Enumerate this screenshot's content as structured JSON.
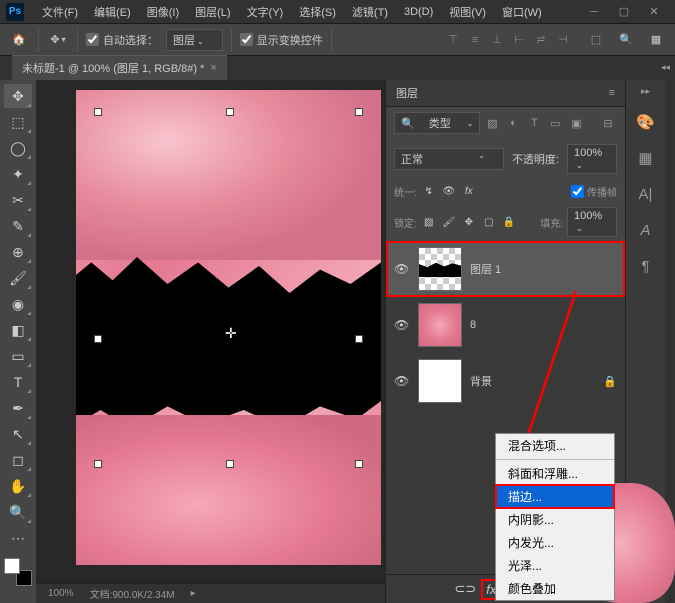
{
  "menubar": {
    "items": [
      "文件(F)",
      "编辑(E)",
      "图像(I)",
      "图层(L)",
      "文字(Y)",
      "选择(S)",
      "滤镜(T)",
      "3D(D)",
      "视图(V)",
      "窗口(W)"
    ]
  },
  "options_bar": {
    "auto_select_label": "自动选择：",
    "auto_select_target": "图层",
    "show_transform_label": "显示变换控件"
  },
  "doc_tab": {
    "title": "未标题-1 @ 100% (图层 1, RGB/8#) *"
  },
  "status": {
    "zoom": "100%",
    "doc_info": "文档:900.0K/2.34M"
  },
  "layers_panel": {
    "title": "图层",
    "filter_label": "类型",
    "blend_mode": "正常",
    "opacity_label": "不透明度:",
    "opacity_value": "100%",
    "unify_label": "统一:",
    "propagate_label": "传播帧",
    "lock_label": "锁定:",
    "fill_label": "填充:",
    "fill_value": "100%",
    "layers": [
      {
        "name": "图层 1",
        "thumb": "checker",
        "highlighted": true,
        "locked": false
      },
      {
        "name": "8",
        "thumb": "petals",
        "highlighted": false,
        "locked": false
      },
      {
        "name": "背景",
        "thumb": "white",
        "highlighted": false,
        "locked": true
      }
    ]
  },
  "fx_menu": {
    "items": [
      {
        "label": "混合选项...",
        "sel": false
      },
      {
        "sep": true
      },
      {
        "label": "斜面和浮雕...",
        "sel": false
      },
      {
        "label": "描边...",
        "sel": true
      },
      {
        "label": "内阴影...",
        "sel": false
      },
      {
        "label": "内发光...",
        "sel": false
      },
      {
        "label": "光泽...",
        "sel": false
      },
      {
        "label": "颜色叠加",
        "sel": false
      }
    ]
  }
}
